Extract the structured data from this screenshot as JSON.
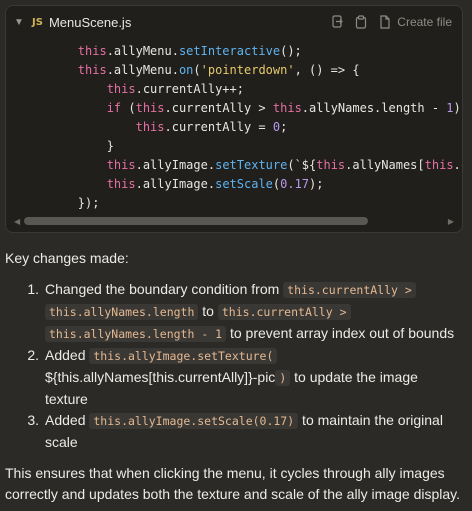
{
  "code_block": {
    "language_badge": "JS",
    "filename": "MenuScene.js",
    "create_file_label": "Create file",
    "icons": [
      "chevron-down-icon",
      "js-file-icon",
      "insert-icon",
      "copy-icon",
      "create-file-icon"
    ],
    "lines": [
      [
        {
          "t": "        "
        },
        {
          "t": "this",
          "c": "kw"
        },
        {
          "t": ".allyMenu."
        },
        {
          "t": "setInteractive",
          "c": "fn"
        },
        {
          "t": "();"
        }
      ],
      [
        {
          "t": "        "
        },
        {
          "t": "this",
          "c": "kw"
        },
        {
          "t": ".allyMenu."
        },
        {
          "t": "on",
          "c": "fn"
        },
        {
          "t": "("
        },
        {
          "t": "'pointerdown'",
          "c": "str"
        },
        {
          "t": ", () => {"
        }
      ],
      [
        {
          "t": "            "
        },
        {
          "t": "this",
          "c": "kw"
        },
        {
          "t": ".currentAlly++;"
        }
      ],
      [
        {
          "t": "            "
        },
        {
          "t": "if",
          "c": "kw"
        },
        {
          "t": " ("
        },
        {
          "t": "this",
          "c": "kw"
        },
        {
          "t": ".currentAlly > "
        },
        {
          "t": "this",
          "c": "kw"
        },
        {
          "t": ".allyNames.length - "
        },
        {
          "t": "1",
          "c": "num"
        },
        {
          "t": ") {"
        }
      ],
      [
        {
          "t": "                "
        },
        {
          "t": "this",
          "c": "kw"
        },
        {
          "t": ".currentAlly = "
        },
        {
          "t": "0",
          "c": "num"
        },
        {
          "t": ";"
        }
      ],
      [
        {
          "t": "            }"
        }
      ],
      [
        {
          "t": "            "
        },
        {
          "t": "this",
          "c": "kw"
        },
        {
          "t": ".allyImage."
        },
        {
          "t": "setTexture",
          "c": "fn"
        },
        {
          "t": "(`${"
        },
        {
          "t": "this",
          "c": "kw"
        },
        {
          "t": ".allyNames["
        },
        {
          "t": "this",
          "c": "kw"
        },
        {
          "t": ".currentAlly]}-pic`);"
        }
      ],
      [
        {
          "t": "            "
        },
        {
          "t": "this",
          "c": "kw"
        },
        {
          "t": ".allyImage."
        },
        {
          "t": "setScale",
          "c": "fn"
        },
        {
          "t": "("
        },
        {
          "t": "0.17",
          "c": "num"
        },
        {
          "t": ");"
        }
      ],
      [
        {
          "t": "        });"
        }
      ]
    ]
  },
  "answer": {
    "intro": "Key changes made:",
    "items": [
      {
        "num": "1.",
        "parts": [
          {
            "t": "Changed the boundary condition from "
          },
          {
            "t": "this.currentAlly >",
            "code": true
          },
          {
            "t": " "
          },
          {
            "t": "this.allyNames.length",
            "code": true
          },
          {
            "t": " to "
          },
          {
            "t": "this.currentAlly >",
            "code": true
          },
          {
            "t": " "
          },
          {
            "t": "this.allyNames.length - 1",
            "code": true
          },
          {
            "t": " to prevent array index out of bounds"
          }
        ]
      },
      {
        "num": "2.",
        "parts": [
          {
            "t": "Added "
          },
          {
            "t": "this.allyImage.setTexture(",
            "code": true
          },
          {
            "t": " ${this.allyNames[this.currentAlly]}-pic"
          },
          {
            "t": ")",
            "code": true
          },
          {
            "t": " to update the image texture"
          }
        ]
      },
      {
        "num": "3.",
        "parts": [
          {
            "t": "Added "
          },
          {
            "t": "this.allyImage.setScale(0.17)",
            "code": true
          },
          {
            "t": " to maintain the original scale"
          }
        ]
      }
    ],
    "summary": "This ensures that when clicking the menu, it cycles through ally images correctly and updates both the texture and scale of the ally image display."
  }
}
